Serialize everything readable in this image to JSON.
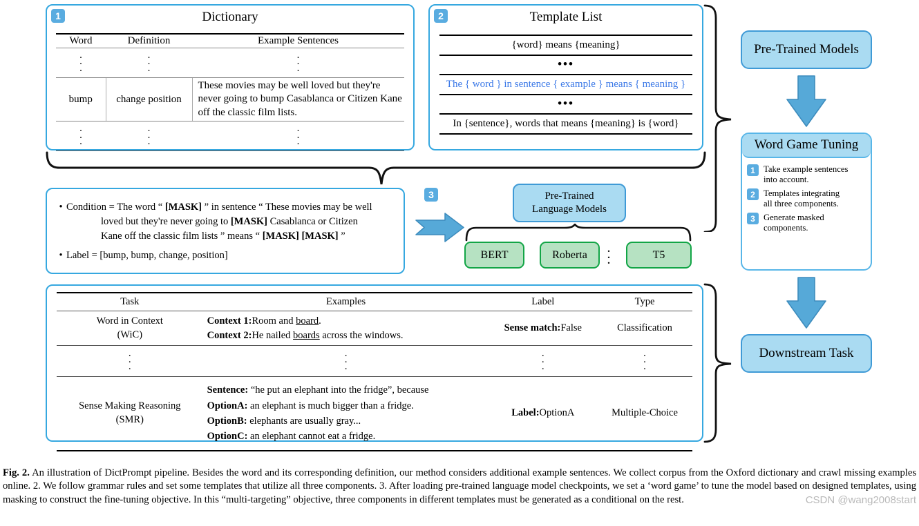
{
  "figure": {
    "dictionary_panel": {
      "badge": "1",
      "title": "Dictionary",
      "columns": [
        "Word",
        "Definition",
        "Example Sentences"
      ],
      "rows": [
        {
          "type": "ellipsis"
        },
        {
          "type": "data",
          "word": "bump",
          "definition": "change position",
          "example": "These movies may be well loved but they're never going to bump Casablanca or Citizen Kane off the classic film lists."
        },
        {
          "type": "ellipsis"
        }
      ]
    },
    "template_panel": {
      "badge": "2",
      "title": "Template List",
      "rows": [
        {
          "text": "{word} means {meaning}",
          "style": "plain"
        },
        {
          "text": "•••",
          "style": "dots"
        },
        {
          "text": "The { word } in sentence { example } means { meaning }",
          "style": "highlight"
        },
        {
          "text": "•••",
          "style": "dots"
        },
        {
          "text": "In {sentence}, words that means {meaning} is {word}",
          "style": "plain"
        }
      ]
    },
    "condition_panel": {
      "condition_label": "Condition = ",
      "condition_line1": "The word “ [MASK] ” in sentence “ These movies may be well",
      "condition_line2_a": "loved but they're never going to ",
      "condition_line2_mask": "[MASK]",
      "condition_line2_b": " Casablanca or Citizen",
      "condition_line3_a": "Kane off the classic film lists ” means “ ",
      "condition_line3_mask": "[MASK] [MASK]",
      "condition_line3_b": " ”",
      "mask_token": "[MASK]",
      "label_text": "Label = [bump, bump, change, position]"
    },
    "step3": {
      "badge": "3",
      "lm_box_line1": "Pre-Trained",
      "lm_box_line2": "Language Models",
      "models": [
        "BERT",
        "Roberta",
        "T5"
      ],
      "models_ellipsis": "⋮"
    },
    "task_table": {
      "columns": [
        "Task",
        "Examples",
        "Label",
        "Type"
      ],
      "rows": [
        {
          "type": "data",
          "task_line1": "Word in Context",
          "task_line2": "(WiC)",
          "examples": [
            {
              "bold": "Context 1:",
              "rest": "Room and ",
              "underline": "board",
              "tail": "."
            },
            {
              "bold": "Context 2:",
              "rest": "He nailed ",
              "underline": "boards",
              "tail": " across the windows."
            }
          ],
          "label_bold": "Sense match:",
          "label_rest": "False",
          "type_text": "Classification"
        },
        {
          "type": "ellipsis"
        },
        {
          "type": "data",
          "task_line1": "Sense Making Reasoning",
          "task_line2": "(SMR)",
          "examples": [
            {
              "bold": "Sentence:",
              "rest": " “he put an elephant into the fridge”, because",
              "underline": "",
              "tail": ""
            },
            {
              "bold": "OptionA:",
              "rest": " an elephant is much bigger than a fridge.",
              "underline": "",
              "tail": ""
            },
            {
              "bold": "OptionB:",
              "rest": " elephants are usually gray...",
              "underline": "",
              "tail": ""
            },
            {
              "bold": "OptionC:",
              "rest": " an elephant cannot eat a fridge.",
              "underline": "",
              "tail": ""
            }
          ],
          "label_bold": "Label:",
          "label_rest": "OptionA",
          "type_text": "Multiple-Choice"
        }
      ]
    },
    "pipeline": {
      "stage1": "Pre-Trained Models",
      "stage2_title": "Word Game Tuning",
      "stage2_items": [
        {
          "badge": "1",
          "line1": "Take example sentences",
          "line2": "into account."
        },
        {
          "badge": "2",
          "line1": "Templates integrating",
          "line2": "all three components."
        },
        {
          "badge": "3",
          "line1": "Generate masked",
          "line2": "components."
        }
      ],
      "stage3": "Downstream Task"
    }
  },
  "caption": {
    "label": "Fig. 2.",
    "body": "An illustration of DictPrompt pipeline. Besides the word and its corresponding definition, our method considers additional example sentences. We collect corpus from the Oxford dictionary and crawl missing examples online. 2. We follow grammar rules and set some templates that utilize all three components. 3. After loading pre-trained language model checkpoints, we set a ‘word game’ to tune the model based on designed templates, using masking to construct the fine-tuning objective. In this “multi-targeting” objective, three components in different templates must be generated as a conditional on the rest.",
    "watermark": "CSDN @wang2008start"
  },
  "colors": {
    "panel_border": "#36a8e0",
    "badge_blue": "#59ace0",
    "arrow_blue": "#56a9d8",
    "lm_fill": "#aadbf2",
    "model_fill": "#b6e2c2",
    "model_border": "#12a546",
    "template_highlight": "#3a78e7",
    "watermark_gray": "#b9b9b9"
  }
}
